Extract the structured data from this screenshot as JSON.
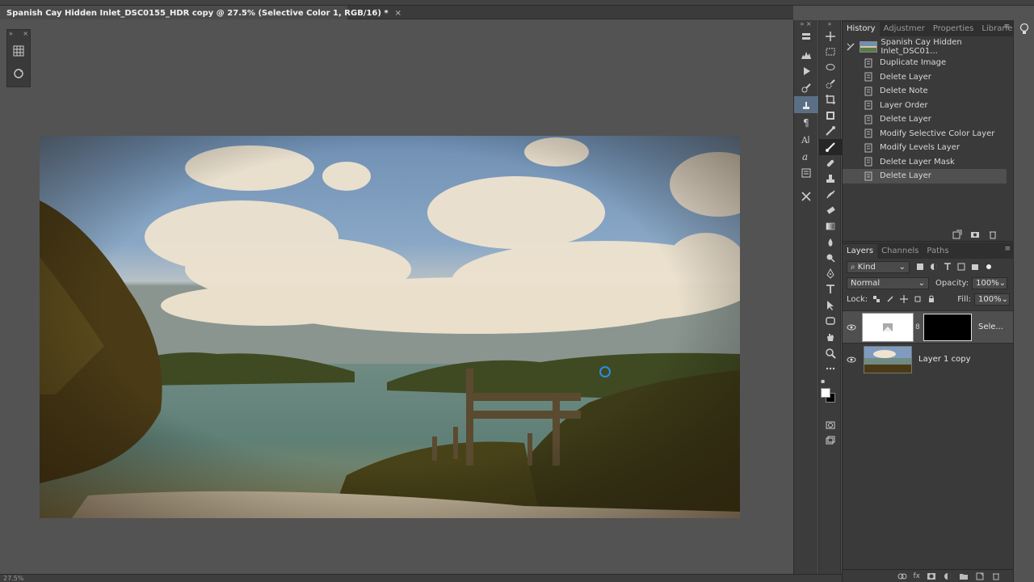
{
  "document": {
    "tab_title": "Spanish Cay Hidden Inlet_DSC0155_HDR copy @ 27.5% (Selective Color 1, RGB/16) *",
    "close_glyph": "×"
  },
  "status": {
    "zoom": "27.5%"
  },
  "dock_tabs": {
    "history": "History",
    "adjustments": "Adjustmer",
    "properties": "Properties",
    "libraries": "Libraries"
  },
  "history": {
    "snapshot_label": "Spanish Cay Hidden Inlet_DSC01...",
    "states": [
      {
        "label": "Duplicate Image"
      },
      {
        "label": "Delete Layer"
      },
      {
        "label": "Delete Note"
      },
      {
        "label": "Layer Order"
      },
      {
        "label": "Delete Layer"
      },
      {
        "label": "Modify Selective Color Layer"
      },
      {
        "label": "Modify Levels Layer"
      },
      {
        "label": "Delete Layer Mask"
      },
      {
        "label": "Delete Layer"
      }
    ],
    "selected_index": 8
  },
  "layers_panel": {
    "tabs": {
      "layers": "Layers",
      "channels": "Channels",
      "paths": "Paths"
    },
    "filter_kind": "Kind",
    "blend_mode": "Normal",
    "opacity_label": "Opacity:",
    "opacity_value": "100%",
    "lock_label": "Lock:",
    "fill_label": "Fill:",
    "fill_value": "100%",
    "layers": [
      {
        "name": "Sele...",
        "type": "adjustment",
        "selected": true
      },
      {
        "name": "Layer 1 copy",
        "type": "pixel",
        "selected": false
      }
    ],
    "footer_fx": "fx"
  },
  "colors": {
    "accent": "#2a8de0",
    "panel_bg": "#3a3a3a",
    "workspace_bg": "#535353",
    "selected_row": "#505050"
  },
  "icons": {
    "mini_panel": [
      "grid-icon",
      "rotate-view-icon"
    ],
    "panel_column": [
      "layer-comps-icon",
      "histogram-icon",
      "play-icon",
      "brush-preset-icon",
      "clone-source-icon",
      "paragraph-icon",
      "character-icon",
      "glyphs-icon",
      "notes-icon",
      "tool-preset-icon"
    ],
    "tools": [
      "move-tool-icon",
      "marquee-tool-icon",
      "lasso-tool-icon",
      "quick-select-tool-icon",
      "crop-tool-icon",
      "frame-tool-icon",
      "eyedropper-tool-icon",
      "healing-brush-icon",
      "brush-tool-icon",
      "clone-stamp-icon",
      "history-brush-icon",
      "eraser-tool-icon",
      "gradient-tool-icon",
      "blur-tool-icon",
      "dodge-tool-icon",
      "pen-tool-icon",
      "type-tool-icon",
      "path-select-icon",
      "shape-tool-icon",
      "hand-tool-icon",
      "zoom-tool-icon",
      "more-tools-icon"
    ]
  }
}
